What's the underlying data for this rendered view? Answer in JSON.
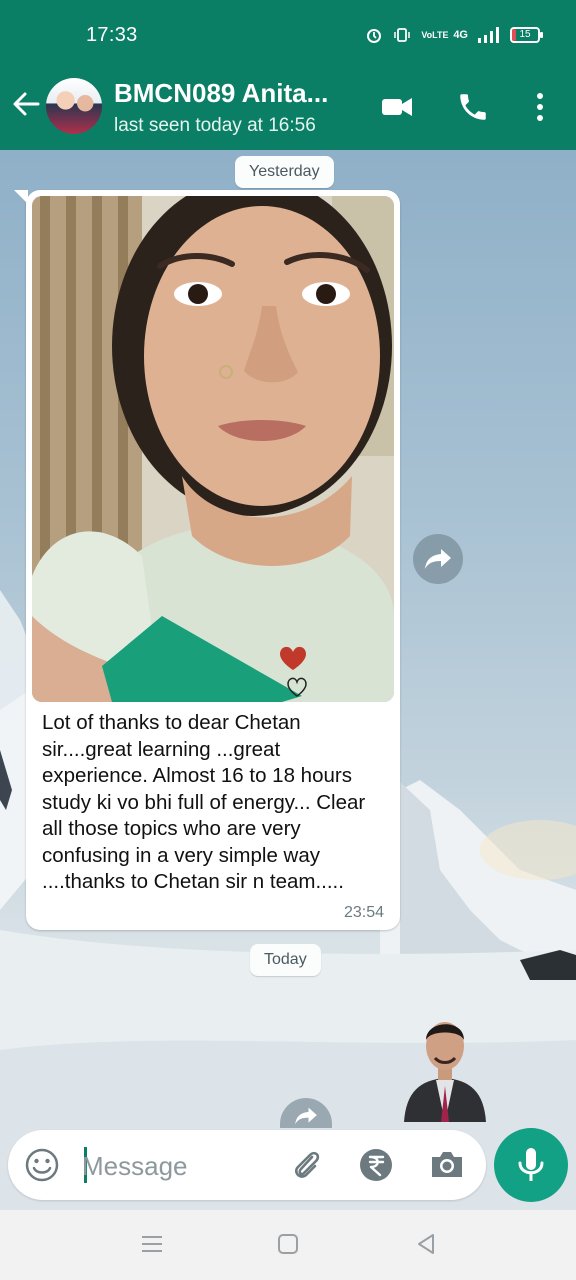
{
  "status_bar": {
    "time": "17:33",
    "network": "4G",
    "volte": "VoLTE",
    "battery": "15",
    "battery_level": 0.15
  },
  "header": {
    "contact_name": "BMCN089  Anita...",
    "last_seen": "last seen today at 16:56",
    "icons": [
      "back-arrow-icon",
      "video-call-icon",
      "phone-icon",
      "more-vert-icon"
    ]
  },
  "chat": {
    "date_yesterday": "Yesterday",
    "message": {
      "text": "Lot of thanks to dear Chetan sir....great learning ...great experience. Almost 16 to 18 hours study ki vo bhi full of energy... Clear all those topics who are very confusing in a very simple way ....thanks to Chetan sir n team.....",
      "time": "23:54"
    },
    "date_today": "Today"
  },
  "composer": {
    "placeholder": "Message",
    "icons": [
      "emoji-icon",
      "attach-icon",
      "rupee-payment-icon",
      "camera-icon",
      "mic-icon"
    ]
  },
  "colors": {
    "header": "#0b7e66",
    "accent": "#13a186",
    "bubble": "#ffffff"
  }
}
